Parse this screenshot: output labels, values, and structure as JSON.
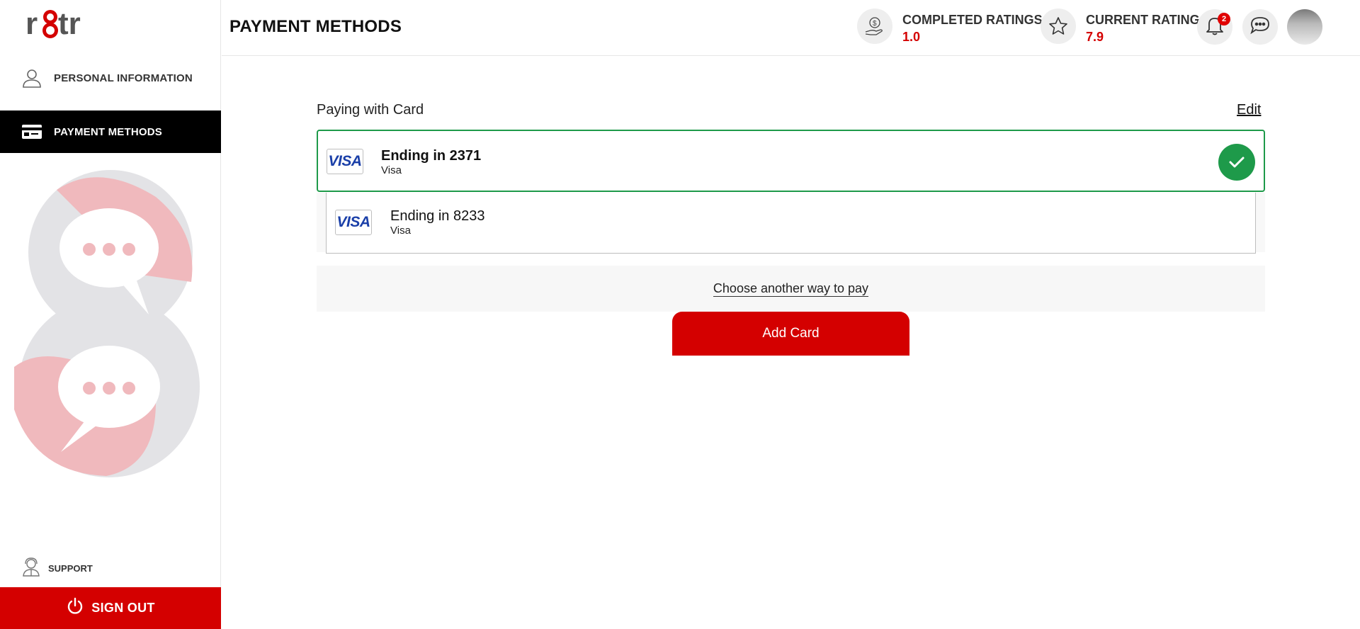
{
  "brand": {
    "logo_text": "r8tr",
    "accent": "#d40000",
    "success": "#1e9a4a"
  },
  "sidebar": {
    "items": [
      {
        "label": "PERSONAL INFORMATION",
        "icon": "user-icon",
        "active": false
      },
      {
        "label": "PAYMENT METHODS",
        "icon": "credit-card-icon",
        "active": true
      }
    ],
    "support": {
      "label": "SUPPORT",
      "icon": "support-agent-icon"
    },
    "signout": {
      "label": "SIGN OUT",
      "icon": "power-icon"
    }
  },
  "header": {
    "title": "PAYMENT METHODS",
    "completed_ratings": {
      "label": "COMPLETED RATINGS",
      "value": "1.0",
      "icon": "money-hand-icon"
    },
    "current_rating": {
      "label": "CURRENT RATING",
      "value": "7.9",
      "icon": "star-icon"
    },
    "notifications": {
      "count": "2",
      "icon": "bell-icon"
    },
    "chat_icon": "chat-icon",
    "avatar": "avatar"
  },
  "main": {
    "section_title": "Paying with Card",
    "edit_label": "Edit",
    "cards": [
      {
        "brand_logo": "VISA",
        "title": "Ending in 2371",
        "subtitle": "Visa",
        "selected": true
      },
      {
        "brand_logo": "VISA",
        "title": "Ending in 8233",
        "subtitle": "Visa",
        "selected": false
      }
    ],
    "choose_other": "Choose another way to pay",
    "add_card": "Add Card"
  }
}
